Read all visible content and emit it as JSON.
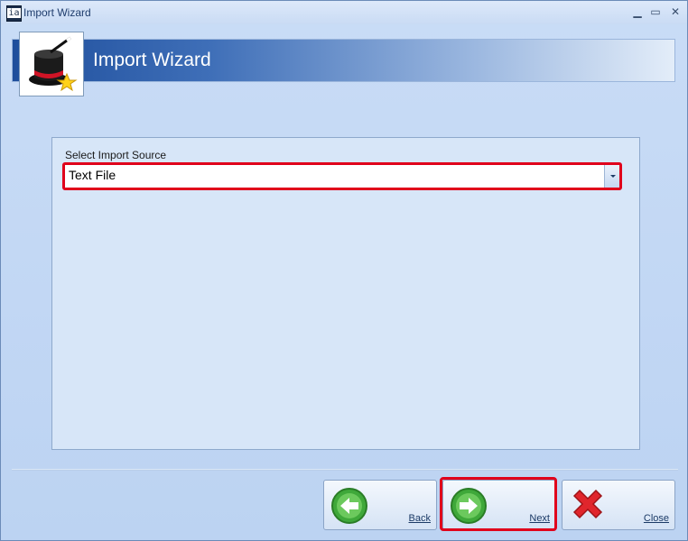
{
  "window": {
    "title": "Import Wizard",
    "app_icon_text": "ia",
    "controls": {
      "minimize": "▁",
      "maximize": "▭",
      "close": "✕"
    }
  },
  "header": {
    "title": "Import Wizard",
    "logo_icon": "magic-hat-star-icon"
  },
  "panel": {
    "source_label": "Select Import Source",
    "source_value": "Text File",
    "source_dropdown_icon": "chevron-down-icon"
  },
  "footer": {
    "back_label": "Back",
    "next_label": "Next",
    "close_label": "Close",
    "back_icon": "arrow-left-icon",
    "next_icon": "arrow-right-icon",
    "close_icon": "red-x-icon"
  },
  "colors": {
    "highlight": "#e0001b",
    "banner_start": "#1e4e9c",
    "banner_end": "#e3edf9"
  }
}
